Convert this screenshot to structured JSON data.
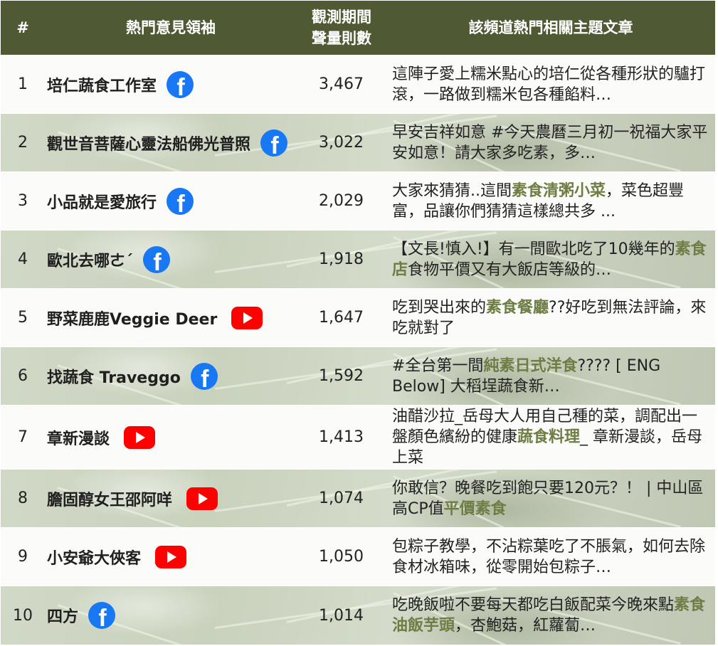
{
  "header": {
    "num": "#",
    "kol": "熱門意見領袖",
    "volume_line1": "觀測期間",
    "volume_line2": "聲量則數",
    "article": "該頻道熱門相關主題文章"
  },
  "rows": [
    {
      "num": "1",
      "name": "培仁蔬食工作室",
      "platform": "facebook-icon",
      "volume": "3,467",
      "article": [
        {
          "t": "這陣子愛上糯米點心的培仁從各種形狀的驢打滾，一路做到糯米包各種餡料…",
          "hl": false
        }
      ]
    },
    {
      "num": "2",
      "name": "觀世音菩薩心靈法船佛光普照",
      "platform": "facebook-icon",
      "volume": "3,022",
      "article": [
        {
          "t": "早安吉祥如意 #今天農曆三月初一祝福大家平安如意！請大家多吃素，多…",
          "hl": false
        }
      ]
    },
    {
      "num": "3",
      "name": "小品就是愛旅行",
      "platform": "facebook-icon",
      "volume": "2,029",
      "article": [
        {
          "t": "大家來猜猜..這間",
          "hl": false
        },
        {
          "t": "素食清粥小菜",
          "hl": true
        },
        {
          "t": "，菜色超豐富，品讓你們猜猜這樣總共多 ...",
          "hl": false
        }
      ]
    },
    {
      "num": "4",
      "name": "歐北去哪ㄜˊ",
      "platform": "facebook-icon",
      "volume": "1,918",
      "article": [
        {
          "t": "【文長!慎入!】有一間歐北吃了10幾年的",
          "hl": false
        },
        {
          "t": "素食店",
          "hl": true
        },
        {
          "t": "食物平價又有大飯店等級的…",
          "hl": false
        }
      ]
    },
    {
      "num": "5",
      "name": "野菜鹿鹿Veggie Deer",
      "platform": "youtube-icon",
      "volume": "1,647",
      "article": [
        {
          "t": " 吃到哭出來的",
          "hl": false
        },
        {
          "t": "素食餐廳",
          "hl": true
        },
        {
          "t": "??好吃到無法評論，來吃就對了",
          "hl": false
        }
      ]
    },
    {
      "num": "6",
      "name": "找蔬食 Traveggo",
      "platform": "facebook-icon",
      "volume": "1,592",
      "article": [
        {
          "t": "#全台第一間",
          "hl": false
        },
        {
          "t": "純素日式洋食",
          "hl": true
        },
        {
          "t": "???? [ ENG Below] 大稻埕蔬食新…",
          "hl": false
        }
      ]
    },
    {
      "num": "7",
      "name": "章新漫談",
      "platform": "youtube-icon",
      "volume": "1,413",
      "article": [
        {
          "t": "油醋沙拉_岳母大人用自己種的菜，調配出一盤顏色繽紛的健康",
          "hl": false
        },
        {
          "t": "蔬食料理",
          "hl": true
        },
        {
          "t": "_ 章新漫談，岳母上菜",
          "hl": false
        }
      ]
    },
    {
      "num": "8",
      "name": "膽固醇女王邵阿咩",
      "platform": "youtube-icon",
      "volume": "1,074",
      "article": [
        {
          "t": " 你敢信？晚餐吃到飽只要120元？！ | 中山區高CP值",
          "hl": false
        },
        {
          "t": "平價素食",
          "hl": true
        }
      ]
    },
    {
      "num": "9",
      "name": "小安爺大俠客",
      "platform": "youtube-icon",
      "volume": "1,050",
      "article": [
        {
          "t": "包粽子教學，不沾粽葉吃了不脹氣，如何去除食材冰箱味，從零開始包粽子…",
          "hl": false
        }
      ]
    },
    {
      "num": "10",
      "name": "四方",
      "platform": "facebook-icon",
      "volume": "1,014",
      "article": [
        {
          "t": "吃晚飯啦不要每天都吃白飯配菜今晚來點",
          "hl": false
        },
        {
          "t": "素食油飯芋頭",
          "hl": true
        },
        {
          "t": "，杏鮑菇，紅蘿蔔…",
          "hl": false
        }
      ]
    }
  ],
  "colors": {
    "header_bg": "#4f5a34",
    "highlight_text": "#6e7d44",
    "facebook": "#1877f2",
    "youtube": "#ff0000"
  }
}
